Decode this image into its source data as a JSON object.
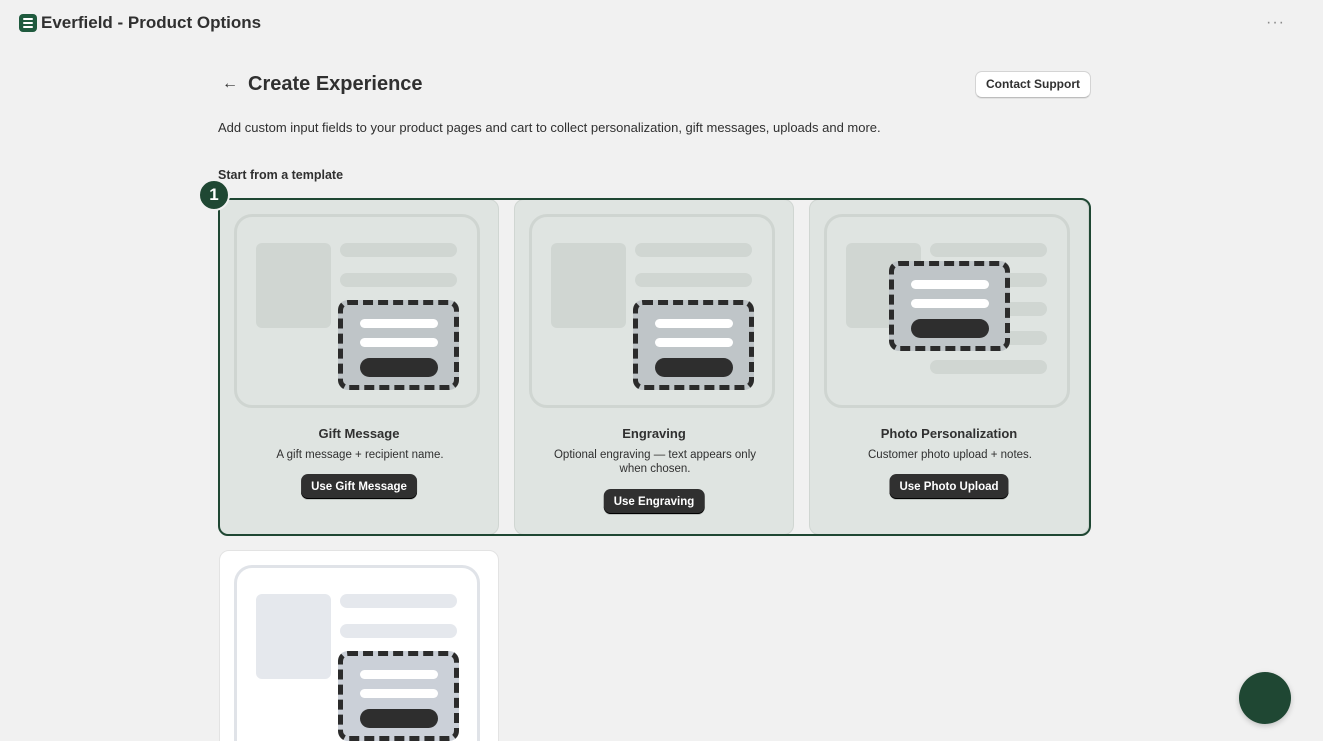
{
  "app": {
    "title": "Everfield - Product Options",
    "icon": "app-list-icon",
    "more_label": "···"
  },
  "page": {
    "back_glyph": "←",
    "title": "Create Experience",
    "support_label": "Contact Support",
    "description": "Add custom input fields to your product pages and cart to collect personalization, gift messages, uploads and more.",
    "section_label": "Start from a template"
  },
  "step": {
    "number": "1"
  },
  "templates": [
    {
      "title": "Gift Message",
      "desc": "A gift message + recipient name.",
      "button": "Use Gift Message"
    },
    {
      "title": "Engraving",
      "desc": "Optional engraving — text appears only when chosen.",
      "button": "Use Engraving"
    },
    {
      "title": "Photo Personalization",
      "desc": "Customer photo upload + notes.",
      "button": "Use Photo Upload"
    }
  ],
  "colors": {
    "brand": "#1f4733",
    "button": "#303030",
    "background": "#f1f1f1"
  }
}
